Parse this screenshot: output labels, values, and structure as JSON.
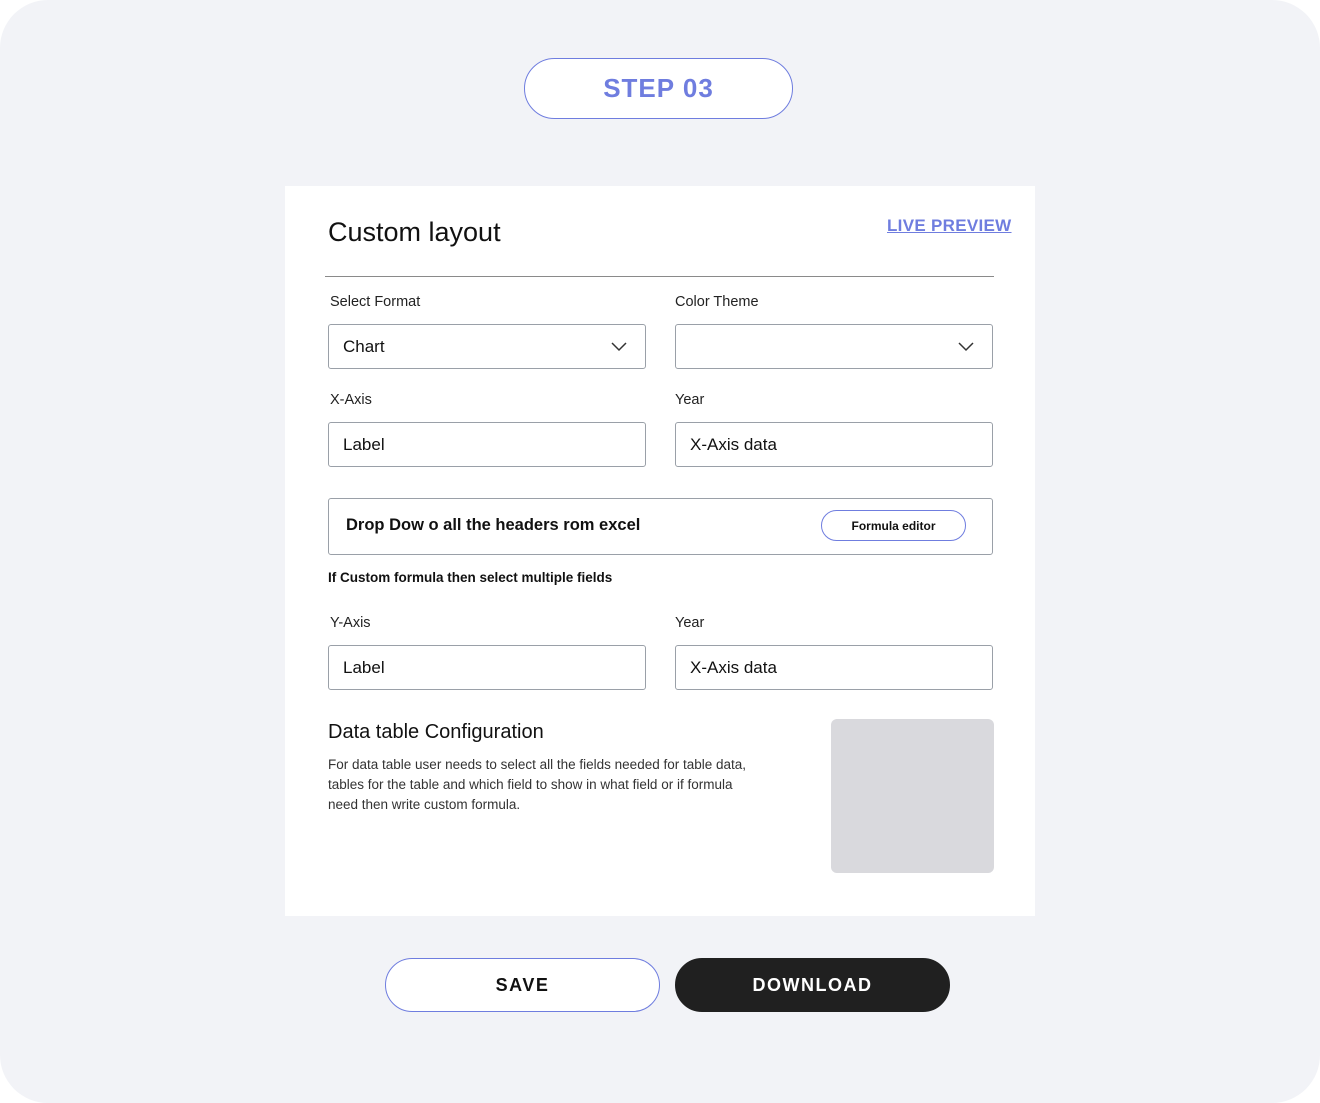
{
  "step": {
    "label": "STEP 03"
  },
  "card": {
    "title": "Custom layout",
    "live_preview_label": "LIVE PREVIEW"
  },
  "select_format": {
    "label": "Select Format",
    "value": "Chart"
  },
  "color_theme": {
    "label": "Color Theme",
    "value": ""
  },
  "x_axis": {
    "label": "X-Axis",
    "value": "Label"
  },
  "x_year": {
    "label": "Year",
    "value": "X-Axis data"
  },
  "headers_dropdown": {
    "text": "Drop Dow o all the headers rom excel",
    "formula_button_label": "Formula editor"
  },
  "hint_text": "If Custom formula then select multiple fields",
  "y_axis": {
    "label": "Y-Axis",
    "value": "Label"
  },
  "y_year": {
    "label": "Year",
    "value": "X-Axis data"
  },
  "data_table": {
    "title": "Data table Configuration",
    "description": "For data table user needs to select all the fields needed for table data, tables for the table and which field to show in what field or if formula need then write custom formula."
  },
  "actions": {
    "save_label": "SAVE",
    "download_label": "DOWNLOAD"
  },
  "colors": {
    "accent": "#6f7ddf",
    "background": "#f2f3f7",
    "dark_button": "#202020"
  }
}
